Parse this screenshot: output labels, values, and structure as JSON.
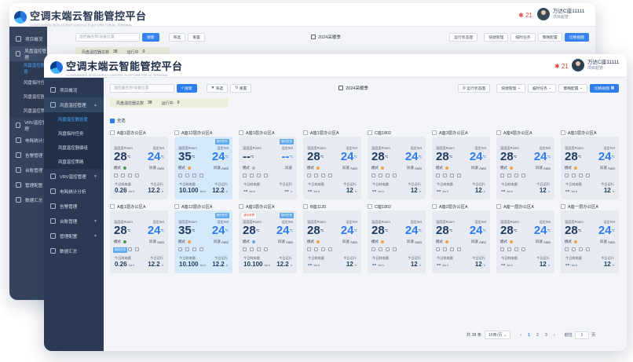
{
  "app": {
    "title": "空调末端云智能管控平台",
    "subtitle": "CLOUD-BASED INTELLIGENT CONTROL PLATFORM FOR AC TERMINAL"
  },
  "header": {
    "alert_count": "21",
    "user_name": "万达C座11111",
    "user_role": "项目超管"
  },
  "sidebar": {
    "items": [
      {
        "label": "项目概况"
      },
      {
        "label": "风盘温控管理"
      },
      {
        "label": "VRV温控管理"
      },
      {
        "label": "电耗统计分析"
      },
      {
        "label": "告警管理"
      },
      {
        "label": "台账管理"
      },
      {
        "label": "管理配置"
      },
      {
        "label": "数据汇总"
      }
    ],
    "subitems": [
      {
        "label": "风盘温控器设置"
      },
      {
        "label": "风盘临时任务"
      },
      {
        "label": "风盘温控器编组"
      },
      {
        "label": "风盘温控策略"
      }
    ],
    "back_subitems": [
      "风盘温控器设",
      "风盘临时任",
      "风盘温控器",
      "风盘温控策"
    ],
    "back_items": [
      "VRV温控管理",
      "电耗统计分",
      "告警管理",
      "台账管理",
      "管理配置",
      "数据汇总"
    ]
  },
  "toolbar": {
    "search_placeholder": "温控器名称/设备位置",
    "search_btn": "搜索",
    "filter_btn": "筛选",
    "reset_btn": "重置",
    "season": "2024采暖季",
    "run_status_btn": "运行状态图",
    "quick_manage": "快捷管理",
    "temp_task": "临时任务",
    "strategy": "策略配置",
    "switch_view": "切换视图"
  },
  "stats": {
    "total_label": "风盘温控器总数",
    "total": "38",
    "running_label": "运行中",
    "running": "0"
  },
  "select_all": "全选",
  "card_labels": {
    "room": "温度度Room",
    "set": "设定Set",
    "mode": "模式",
    "fan": "风速",
    "today_power": "今日耗电量",
    "today_run": "今日运行",
    "kwh": "kw·h",
    "h": "h"
  },
  "cards": [
    {
      "name": "A座1层办公区A",
      "room": "28",
      "set": "24",
      "fan": "Auto",
      "power": "0.26",
      "run": "12.2",
      "hl": false,
      "mode_color": "#46a04b"
    },
    {
      "name": "A座12层办公区A",
      "room": "35",
      "set": "24",
      "fan": "Auto",
      "power": "10.100",
      "run": "12.2",
      "hl": true,
      "tag": "临时任务",
      "mode_color": "#f0a24a"
    },
    {
      "name": "A座1层办公区A",
      "room": "--",
      "set": "--",
      "fan": "",
      "power": "--",
      "run": "--",
      "hl": false,
      "tag": "临时任务",
      "mode_color": "#b0b7c3"
    },
    {
      "name": "A座1层办公区A",
      "room": "28",
      "set": "24",
      "fan": "Auto",
      "power": "--",
      "run": "12",
      "hl": false,
      "mode_color": "#f0a24a"
    },
    {
      "name": "C座1802",
      "room": "28",
      "set": "24",
      "fan": "Auto",
      "power": "--",
      "run": "12",
      "hl": false,
      "mode_color": "#f0a24a"
    },
    {
      "name": "A座3层办公区A",
      "room": "28",
      "set": "24",
      "fan": "Auto",
      "power": "--",
      "run": "12",
      "hl": false,
      "mode_color": "#f0a24a"
    },
    {
      "name": "A座4层办公区A",
      "room": "28",
      "set": "24",
      "fan": "Auto",
      "power": "--",
      "run": "12",
      "hl": false,
      "mode_color": "#f0a24a"
    },
    {
      "name": "A座1层办公区A",
      "room": "28",
      "set": "24",
      "fan": "Auto",
      "power": "--",
      "run": "12",
      "hl": false,
      "mode_color": "#f0a24a"
    },
    {
      "name": "A座1层办公区A",
      "room": "28",
      "set": "24",
      "fan": "Auto",
      "power": "0.26",
      "run": "12.2",
      "hl": false,
      "mode_color": "#46a04b",
      "tag_bl": "临时任务"
    },
    {
      "name": "A座12层办公区A",
      "room": "35",
      "set": "24",
      "fan": "Auto",
      "power": "10.100",
      "run": "12.2",
      "hl": true,
      "tag": "临时任务",
      "mode_color": "#f0a24a"
    },
    {
      "name": "A座1层办公区A",
      "room": "28",
      "set": "24",
      "fan": "Auto",
      "power": "10.100",
      "run": "12.2",
      "hl": false,
      "tag_red": "通讯故障",
      "tag": "临时任务",
      "mode_color": "#5fa9ea"
    },
    {
      "name": "B座1120",
      "room": "28",
      "set": "24",
      "fan": "Auto",
      "power": "--",
      "run": "12",
      "hl": false,
      "mode_color": "#f0a24a"
    },
    {
      "name": "C座1802",
      "room": "28",
      "set": "24",
      "fan": "Auto",
      "power": "--",
      "run": "12",
      "hl": false,
      "mode_color": "#f0a24a"
    },
    {
      "name": "A座2层办公区A",
      "room": "28",
      "set": "24",
      "fan": "Auto",
      "power": "--",
      "run": "12",
      "hl": false,
      "mode_color": "#f0a24a"
    },
    {
      "name": "A座一层办公区A",
      "room": "28",
      "set": "24",
      "fan": "Auto",
      "power": "--",
      "run": "12",
      "hl": false,
      "mode_color": "#f0a24a"
    },
    {
      "name": "A座一层办公区A",
      "room": "28",
      "set": "24",
      "fan": "Auto",
      "power": "--",
      "run": "12",
      "hl": false,
      "mode_color": "#f0a24a"
    }
  ],
  "pagination": {
    "total": "共 38 条",
    "page_size": "16条/页",
    "pages": [
      "1",
      "2",
      "3"
    ],
    "current": "1",
    "goto_label": "前往",
    "goto_value": "1",
    "page_unit": "页"
  },
  "colors": {
    "sidebar_bg": "#2a3a55",
    "accent": "#2d7cf0",
    "highlight_card": "#d5e9f8"
  }
}
